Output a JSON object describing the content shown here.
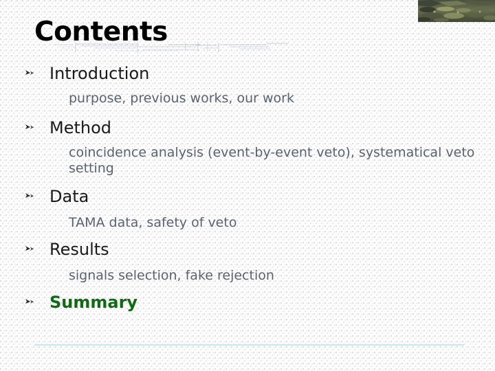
{
  "slide": {
    "title": "Contents",
    "header_thumbnail": {
      "name": "aerial-landscape-photo",
      "alt": "aerial satellite photograph of terrain"
    },
    "accent_color": "#0e6b12",
    "subtext_color": "#5a6272",
    "rule_color": "#c7e8f0",
    "bullet_icon": "arrow-dart-bullet-icon",
    "items": [
      {
        "label": "Introduction",
        "detail": "purpose, previous works, our work",
        "highlight": false
      },
      {
        "label": "Method",
        "detail": "coincidence analysis (event-by-event veto), systematical veto setting",
        "highlight": false
      },
      {
        "label": "Data",
        "detail": "TAMA data, safety of veto",
        "highlight": false
      },
      {
        "label": "Results",
        "detail": "signals selection, fake rejection",
        "highlight": false
      },
      {
        "label": "Summary",
        "detail": "",
        "highlight": true
      }
    ]
  }
}
